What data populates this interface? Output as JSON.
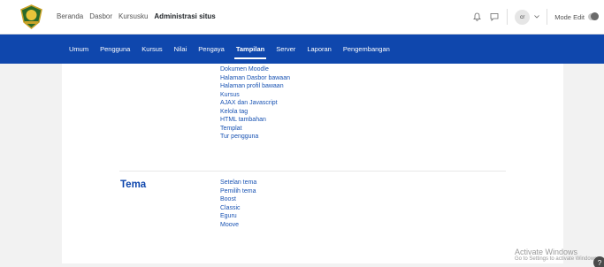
{
  "primary_nav": {
    "items": [
      "Beranda",
      "Dasbor",
      "Kursusku",
      "Administrasi situs"
    ],
    "active_index": 3
  },
  "user_menu": {
    "initials": "cr",
    "mode_edit_label": "Mode Edit"
  },
  "admin_tabs": [
    "Umum",
    "Pengguna",
    "Kursus",
    "Nilai",
    "Pengaya",
    "Tampilan",
    "Server",
    "Laporan",
    "Pengembangan"
  ],
  "admin_tabs_active_index": 5,
  "appearance": {
    "links": [
      "Dokumen Moodle",
      "Halaman Dasbor bawaan",
      "Halaman profil bawaan",
      "Kursus",
      "AJAX dan Javascript",
      "Kelola tag",
      "HTML tambahan",
      "Templat",
      "Tur pengguna"
    ],
    "theme_section_title": "Tema",
    "theme_links": [
      "Setelan tema",
      "Pemilih tema",
      "Boost",
      "Classic",
      "Eguru",
      "Moove"
    ]
  },
  "watermark": {
    "title": "Activate Windows",
    "subtitle": "Go to Settings to activate Windows."
  },
  "colors": {
    "tabs_bar": "#0f47ad",
    "link": "#1953b3"
  },
  "icons": [
    "site-logo",
    "bell-icon",
    "chat-icon",
    "chevron-down-icon",
    "help-icon"
  ]
}
